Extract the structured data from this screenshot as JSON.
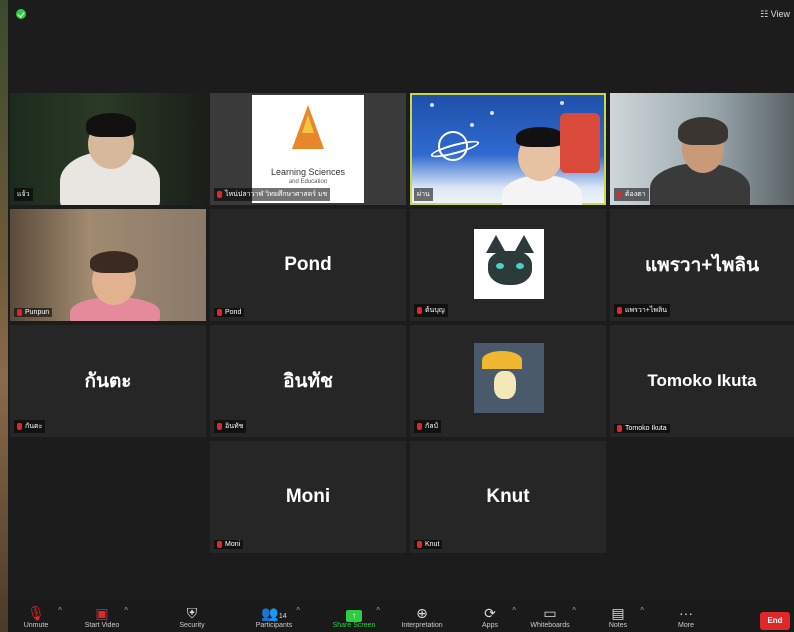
{
  "topbar": {
    "view_label": "View"
  },
  "tiles": [
    {
      "id": "t1",
      "name": "",
      "tag": "แจ้ว",
      "muted": false
    },
    {
      "id": "t2",
      "name": "",
      "tag": "ไหน่ปลาวาฬ วิทยศึกษาศาสตร์ มช",
      "muted": true
    },
    {
      "id": "t3",
      "name": "",
      "tag": "ผ่าน",
      "muted": false
    },
    {
      "id": "t4",
      "name": "",
      "tag": "ต้องตา",
      "muted": true
    },
    {
      "id": "t5",
      "name": "",
      "tag": "Punpun",
      "muted": true
    },
    {
      "id": "t6",
      "name": "Pond",
      "tag": "Pond",
      "muted": true
    },
    {
      "id": "t7",
      "name": "",
      "tag": "ต้นบุญ",
      "muted": true
    },
    {
      "id": "t8",
      "name": "แพรวา+ไพลิน",
      "tag": "แพรวา+ไพลิน",
      "muted": true
    },
    {
      "id": "t9",
      "name": "กันตะ",
      "tag": "กันตะ",
      "muted": true
    },
    {
      "id": "t10",
      "name": "อินทัช",
      "tag": "อินทัช",
      "muted": true
    },
    {
      "id": "t11",
      "name": "",
      "tag": "กัลป์",
      "muted": true
    },
    {
      "id": "t12",
      "name": "Tomoko Ikuta",
      "tag": "Tomoko Ikuta",
      "muted": true
    },
    {
      "id": "t13",
      "name": "Moni",
      "tag": "Moni",
      "muted": true
    },
    {
      "id": "t14",
      "name": "Knut",
      "tag": "Knut",
      "muted": true
    }
  ],
  "logo": {
    "line1": "Learning Sciences",
    "line2": "and Education"
  },
  "toolbar": {
    "unmute": "Unmute",
    "start_video": "Start Video",
    "security": "Security",
    "participants": "Participants",
    "participants_count": "14",
    "share_screen": "Share Screen",
    "interpretation": "Interpretation",
    "apps": "Apps",
    "whiteboards": "Whiteboards",
    "notes": "Notes",
    "more": "More",
    "end": "End"
  },
  "colors": {
    "active_speaker": "#c8d94a",
    "share_green": "#2ecc40",
    "end_red": "#e02828"
  }
}
